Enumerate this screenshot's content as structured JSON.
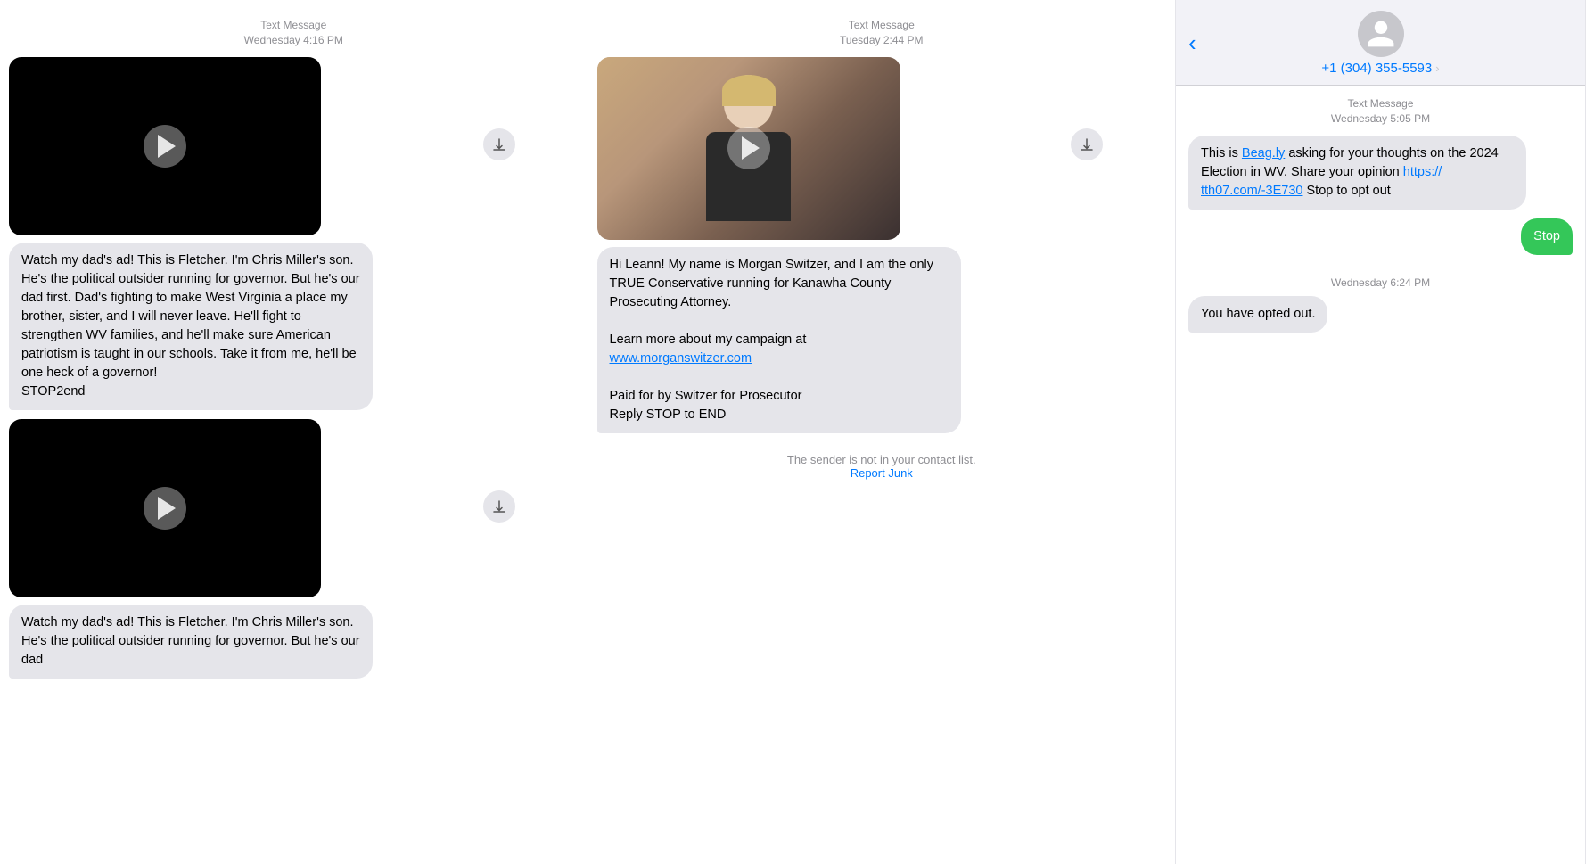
{
  "panel1": {
    "time_header": "Text Message\nWednesday 4:16 PM",
    "msg1_text": "Watch my dad's ad! This is Fletcher. I'm Chris Miller's son. He's the political outsider running for governor. But he's our dad first. Dad's fighting to make West Virginia a place my brother, sister, and I will never leave. He'll fight to strengthen WV families, and he'll make sure American patriotism is taught in our schools. Take it from me, he'll be one heck of a governor!\nSTOP2end",
    "msg2_text": "Watch my dad's ad! This is Fletcher. I'm Chris Miller's son. He's the political outsider running for governor. But he's our dad",
    "download_label": "Download"
  },
  "panel2": {
    "time_header": "Text Message\nTuesday 2:44 PM",
    "msg_text_part1": "Hi Leann! My name is Morgan Switzer, and I am the only TRUE Conservative running for Kanawha County Prosecuting Attorney.\n\nLearn more about my campaign at ",
    "msg_link": "www.morganswitzer.com",
    "msg_text_part2": "\n\nPaid for by Switzer for Prosecutor\nReply STOP to END",
    "junk_notice": "The sender is not in your contact list.",
    "report_junk": "Report Junk",
    "download_label": "Download"
  },
  "panel3": {
    "phone": "+1 (304) 355-5593",
    "time_header": "Text Message\nWednesday 5:05 PM",
    "msg1_text_before_link1": "This is ",
    "msg1_link1": "Beag.ly",
    "msg1_link1_url": "https://beag.ly",
    "msg1_text_after_link1": " asking for your thoughts on the 2024 Election in WV. Share your opinion ",
    "msg1_link2": "https://\ntth07.com/-3E730",
    "msg1_link2_url": "https://tth07.com/-3E730",
    "msg1_text_end": " Stop to opt out",
    "msg2_text": "Stop",
    "opted_out_time": "Wednesday 6:24 PM",
    "msg3_text": "You have opted out.",
    "back_label": "‹"
  }
}
